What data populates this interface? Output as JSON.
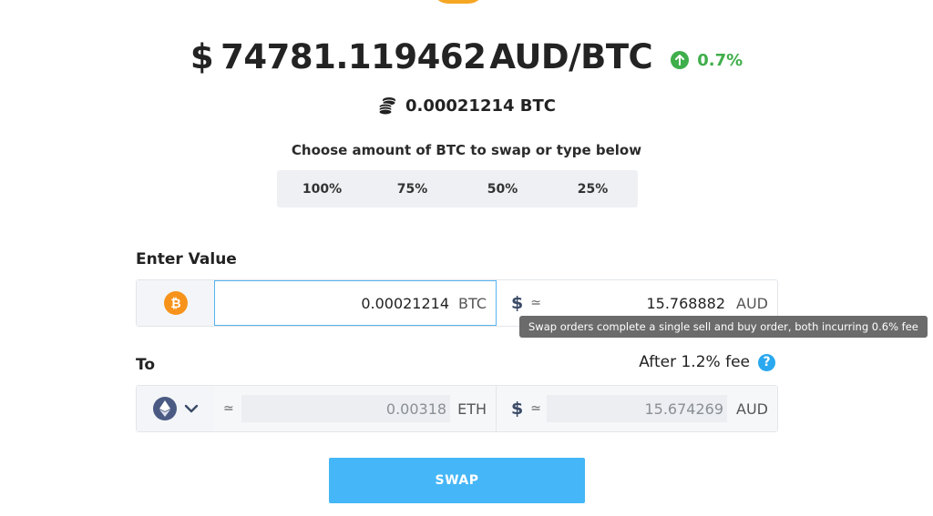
{
  "header": {
    "currency_symbol": "$",
    "price": "74781.119462",
    "pair": "AUD/BTC",
    "change_percent": "0.7%",
    "change_direction": "up",
    "change_color": "#3fae4b"
  },
  "balance": {
    "icon": "coins-icon",
    "amount": "0.00021214 BTC"
  },
  "amount_picker": {
    "label": "Choose amount of BTC to swap or type below",
    "options": [
      "100%",
      "75%",
      "50%",
      "25%"
    ]
  },
  "enter_value": {
    "label": "Enter Value",
    "coin_icon": "bitcoin-icon",
    "coin_color": "#f7931a",
    "crypto_value": "0.00021214",
    "crypto_unit": "BTC",
    "fiat_symbol": "$",
    "approx": "≃",
    "fiat_value": "15.768882",
    "fiat_unit": "AUD"
  },
  "tooltip": {
    "text": "Swap orders complete a single sell and buy order, both incurring 0.6% fee"
  },
  "to": {
    "label": "To",
    "fee_label": "After 1.2% fee",
    "help_icon": "?",
    "coin_icon": "ethereum-icon",
    "approx": "≃",
    "crypto_value": "0.00318",
    "crypto_unit": "ETH",
    "fiat_symbol": "$",
    "fiat_value": "15.674269",
    "fiat_unit": "AUD"
  },
  "swap_button": {
    "label": "SWAP",
    "color": "#45b6f7"
  }
}
